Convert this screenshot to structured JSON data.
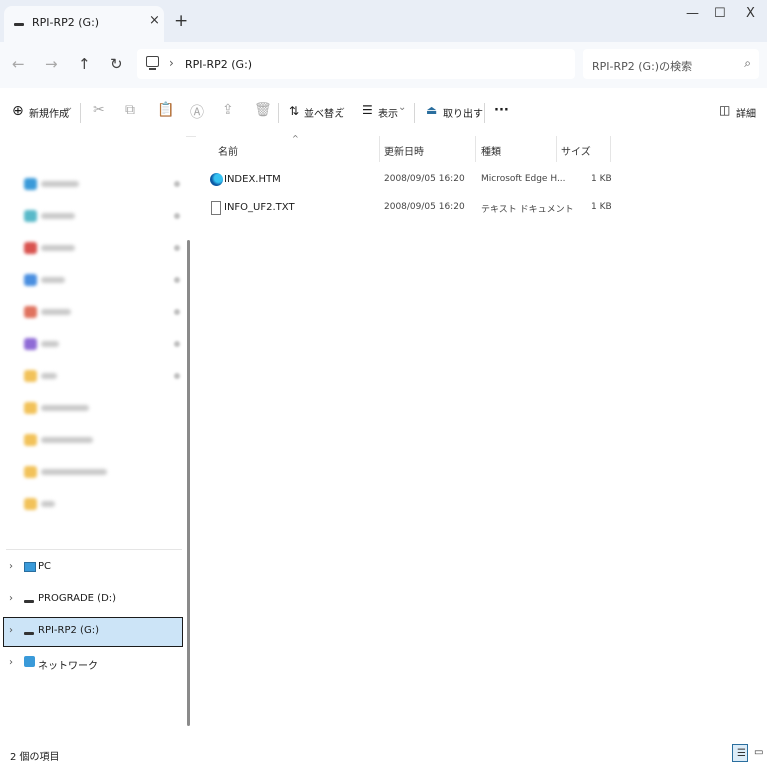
{
  "window": {
    "tab_title": "RPI-RP2 (G:)",
    "new_tab": "+",
    "tab_close": "×",
    "minimize": "—",
    "maximize": "☐",
    "close": "X"
  },
  "address": {
    "nav_back": "←",
    "nav_forward": "→",
    "nav_up": "↑",
    "refresh": "↻",
    "separator": "›",
    "path": "RPI-RP2 (G:)",
    "search_placeholder": "RPI-RP2 (G:)の検索",
    "search_icon": "⌕"
  },
  "toolbar": {
    "new_label": "新規作成",
    "new_icon": "⊕",
    "sort_label": "並べ替え",
    "view_label": "表示",
    "eject_label": "取り出す",
    "more_label": "···",
    "details_label": "詳細",
    "dropdown_chevron": "⌄"
  },
  "sidebar": {
    "chevron": "›",
    "items": [
      {
        "label": "PC"
      },
      {
        "label": "PROGRADE (D:)"
      },
      {
        "label": "RPI-RP2 (G:)"
      },
      {
        "label": "ネットワーク"
      }
    ]
  },
  "columns": {
    "name": "名前",
    "modified": "更新日時",
    "type": "種類",
    "size": "サイズ",
    "sort_indicator": "^"
  },
  "files": [
    {
      "name": "INDEX.HTM",
      "modified": "2008/09/05 16:20",
      "type": "Microsoft Edge H...",
      "size": "1 KB",
      "icon": "edge-icon"
    },
    {
      "name": "INFO_UF2.TXT",
      "modified": "2008/09/05 16:20",
      "type": "テキスト ドキュメント",
      "size": "1 KB",
      "icon": "text-file-icon"
    }
  ],
  "status": {
    "item_count": "2 個の項目"
  },
  "colors": {
    "selected_bg": "#cce4f7",
    "titlebar_bg": "#e9eef6",
    "addressbar_bg": "#f7f9fc"
  }
}
